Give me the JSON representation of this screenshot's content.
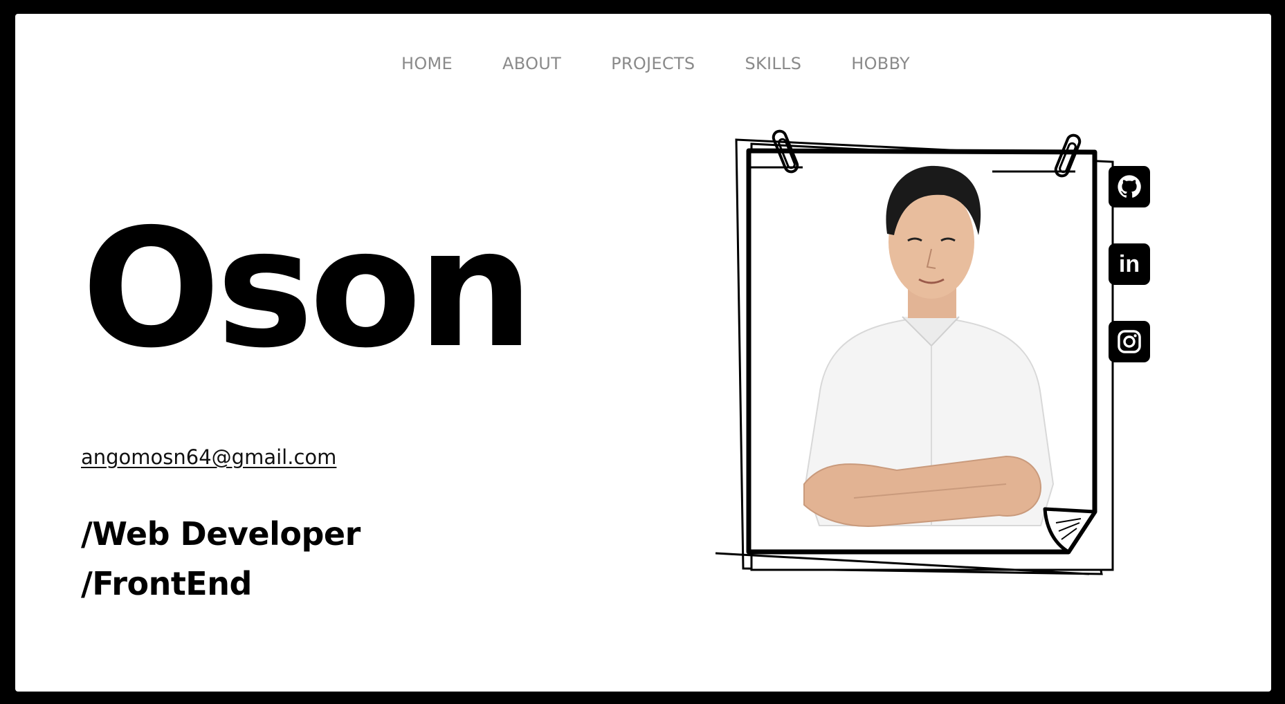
{
  "nav": {
    "items": [
      {
        "label": "HOME"
      },
      {
        "label": "ABOUT"
      },
      {
        "label": "PROJECTS"
      },
      {
        "label": "SKILLS"
      },
      {
        "label": "HOBBY"
      }
    ]
  },
  "hero": {
    "name": "Oson",
    "email": "angomosn64@gmail.com",
    "roles": [
      "/Web Developer",
      "/FrontEnd"
    ]
  },
  "social": {
    "icons": [
      "github-icon",
      "linkedin-icon",
      "instagram-icon"
    ],
    "linkedin_text": "in"
  },
  "colors": {
    "background": "#ffffff",
    "text": "#000000",
    "nav_text": "#8a8a8a",
    "frame_border": "#000000"
  }
}
